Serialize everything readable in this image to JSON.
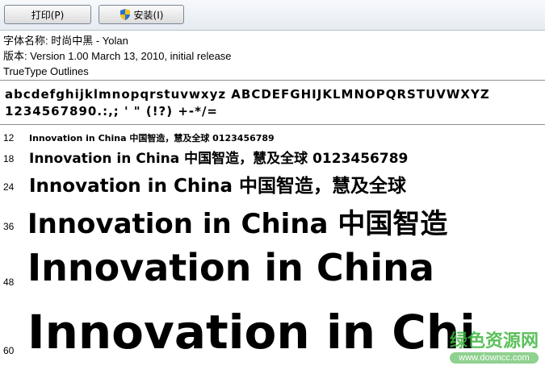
{
  "toolbar": {
    "print_label": "打印(P)",
    "install_label": "安装(I)"
  },
  "info": {
    "font_name": "字体名称: 时尚中黑  - Yolan",
    "version": "版本: Version 1.00 March 13, 2010, initial release",
    "outline_type": "TrueType Outlines"
  },
  "charset": {
    "line1": "abcdefghijklmnopqrstuvwxyz ABCDEFGHIJKLMNOPQRSTUVWXYZ",
    "line2": "1234567890.:,; ' \" (!?) +-*/="
  },
  "samples": [
    {
      "size": "12",
      "text": "Innovation in China 中国智造，慧及全球 0123456789"
    },
    {
      "size": "18",
      "text": "Innovation in China 中国智造，慧及全球 0123456789"
    },
    {
      "size": "24",
      "text": "Innovation in China 中国智造，慧及全球"
    },
    {
      "size": "36",
      "text": "Innovation in China 中国智造"
    },
    {
      "size": "48",
      "text": "Innovation in China"
    },
    {
      "size": "60",
      "text": "Innovation in Chi"
    }
  ],
  "watermark": {
    "title": "绿色资源网",
    "url": "www.downcc.com"
  },
  "colors": {
    "watermark_green": "#3fb63f",
    "toolbar_bg": "#e6ebf2"
  }
}
